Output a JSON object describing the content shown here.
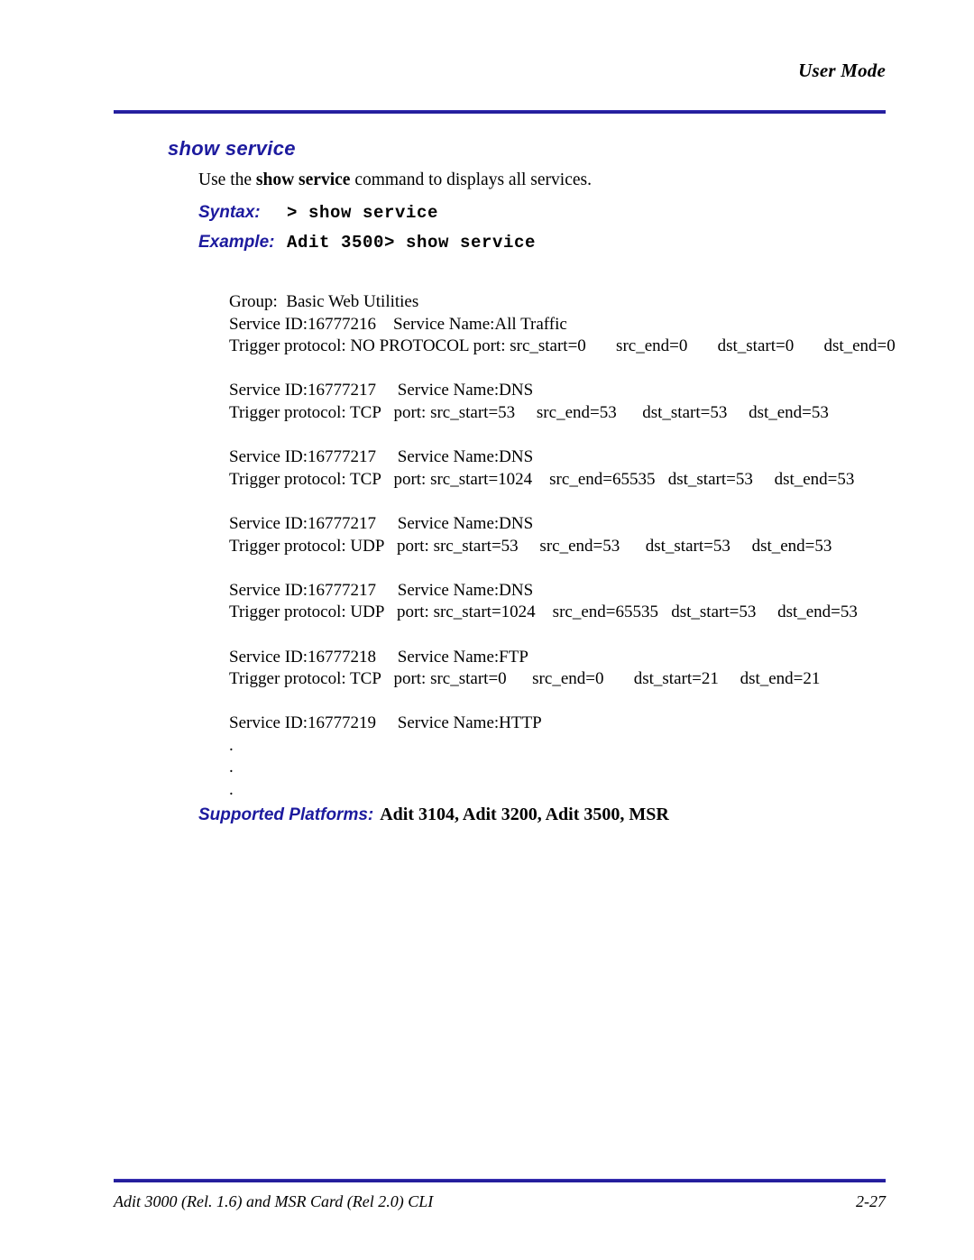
{
  "page": {
    "running_head": "User Mode",
    "section_title": "show service"
  },
  "intro": {
    "before": "Use the ",
    "command": "show service",
    "after": " command to displays all services."
  },
  "syntax": {
    "label": "Syntax:",
    "value": "> show service"
  },
  "example": {
    "label": "Example:",
    "value": "Adit 3500> show service"
  },
  "cli_output": {
    "group_line": "Group:  Basic Web Utilities",
    "entries": [
      {
        "id_line": "Service ID:16777216    Service Name:All Traffic",
        "trigger_line": "Trigger protocol: NO PROTOCOL port: src_start=0       src_end=0       dst_start=0       dst_end=0"
      },
      {
        "id_line": "Service ID:16777217     Service Name:DNS",
        "trigger_line": "Trigger protocol: TCP   port: src_start=53     src_end=53      dst_start=53     dst_end=53"
      },
      {
        "id_line": "Service ID:16777217     Service Name:DNS",
        "trigger_line": "Trigger protocol: TCP   port: src_start=1024    src_end=65535   dst_start=53     dst_end=53"
      },
      {
        "id_line": "Service ID:16777217     Service Name:DNS",
        "trigger_line": "Trigger protocol: UDP   port: src_start=53     src_end=53      dst_start=53     dst_end=53"
      },
      {
        "id_line": "Service ID:16777217     Service Name:DNS",
        "trigger_line": "Trigger protocol: UDP   port: src_start=1024    src_end=65535   dst_start=53     dst_end=53"
      },
      {
        "id_line": "Service ID:16777218     Service Name:FTP",
        "trigger_line": "Trigger protocol: TCP   port: src_start=0      src_end=0       dst_start=21     dst_end=21"
      },
      {
        "id_line": "Service ID:16777219     Service Name:HTTP",
        "trigger_line": ""
      }
    ],
    "continuation_dots": [
      ".",
      ".",
      "."
    ]
  },
  "supported_platforms": {
    "label": "Supported Platforms:",
    "value": "Adit 3104, Adit 3200, Adit 3500, MSR"
  },
  "footer": {
    "document": "Adit 3000 (Rel. 1.6) and MSR Card (Rel 2.0) CLI",
    "page_number": "2-27"
  },
  "colors": {
    "accent_navy": "#1c1a9e",
    "rule_navy": "#241e9c",
    "text_black": "#000000",
    "page_background": "#ffffff"
  }
}
